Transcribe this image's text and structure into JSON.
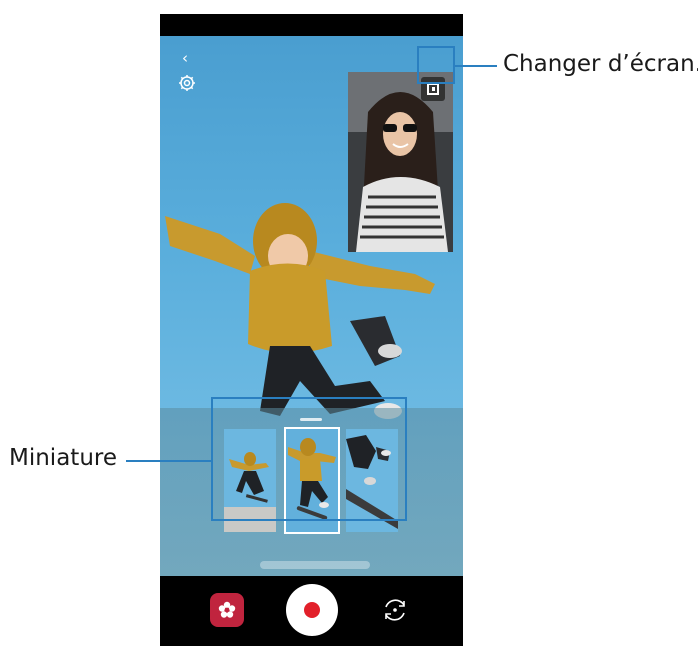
{
  "callouts": {
    "switch_screen": "Changer d’écran.",
    "thumbnail": "Miniature"
  },
  "icons": {
    "back": "back-arrow-icon",
    "settings": "gear-icon",
    "swap": "swap-screen-icon",
    "effects": "flower-effects-icon",
    "record": "record-icon",
    "flip": "flip-camera-icon"
  },
  "colors": {
    "callout": "#2a7fc0",
    "record": "#e2202a",
    "effects": "#c0243e"
  },
  "thumbnails": {
    "count": 3,
    "selected_index": 1
  }
}
